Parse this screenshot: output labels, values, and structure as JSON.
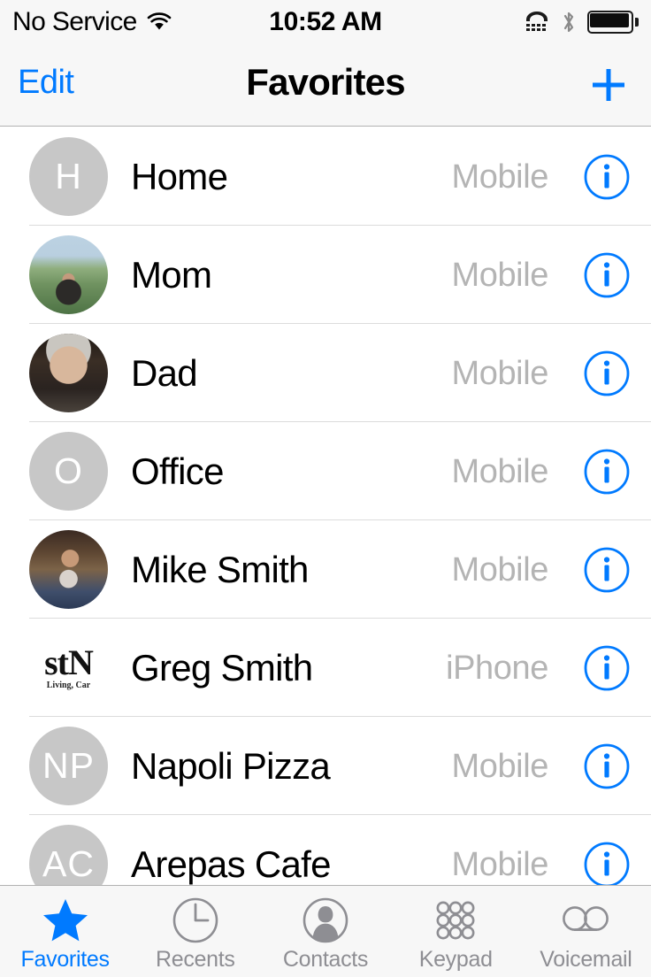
{
  "status_bar": {
    "carrier": "No Service",
    "wifi_icon": "wifi-icon",
    "time": "10:52 AM",
    "tty_icon": "tty-icon",
    "bluetooth_icon": "bluetooth-icon",
    "battery_icon": "battery-full-icon"
  },
  "nav_bar": {
    "edit_label": "Edit",
    "title": "Favorites",
    "add_icon": "plus-icon"
  },
  "favorites": [
    {
      "name": "Home",
      "label": "Mobile",
      "avatar_type": "initials",
      "initials": "H",
      "photo_class": ""
    },
    {
      "name": "Mom",
      "label": "Mobile",
      "avatar_type": "photo",
      "initials": "",
      "photo_class": "ph-mom"
    },
    {
      "name": "Dad",
      "label": "Mobile",
      "avatar_type": "photo",
      "initials": "",
      "photo_class": "ph-dad"
    },
    {
      "name": "Office",
      "label": "Mobile",
      "avatar_type": "initials",
      "initials": "O",
      "photo_class": ""
    },
    {
      "name": "Mike Smith",
      "label": "Mobile",
      "avatar_type": "photo",
      "initials": "",
      "photo_class": "ph-mike"
    },
    {
      "name": "Greg Smith",
      "label": "iPhone",
      "avatar_type": "logo",
      "initials": "stN",
      "photo_class": "",
      "logo_sub": "Living, Car"
    },
    {
      "name": "Napoli Pizza",
      "label": "Mobile",
      "avatar_type": "initials",
      "initials": "NP",
      "photo_class": ""
    },
    {
      "name": "Arepas Cafe",
      "label": "Mobile",
      "avatar_type": "initials",
      "initials": "AC",
      "photo_class": ""
    }
  ],
  "row_info_icon": "info-circle-icon",
  "tabs": [
    {
      "label": "Favorites",
      "icon": "star-icon",
      "active": true
    },
    {
      "label": "Recents",
      "icon": "clock-icon",
      "active": false
    },
    {
      "label": "Contacts",
      "icon": "person-icon",
      "active": false
    },
    {
      "label": "Keypad",
      "icon": "keypad-icon",
      "active": false
    },
    {
      "label": "Voicemail",
      "icon": "voicemail-icon",
      "active": false
    }
  ],
  "colors": {
    "accent_blue": "#007aff",
    "inactive_grey": "#8e8e93",
    "label_grey": "#b4b4b4",
    "avatar_grey": "#c7c7c7",
    "bar_background": "#f7f7f7",
    "separator": "#dcdcdc"
  }
}
